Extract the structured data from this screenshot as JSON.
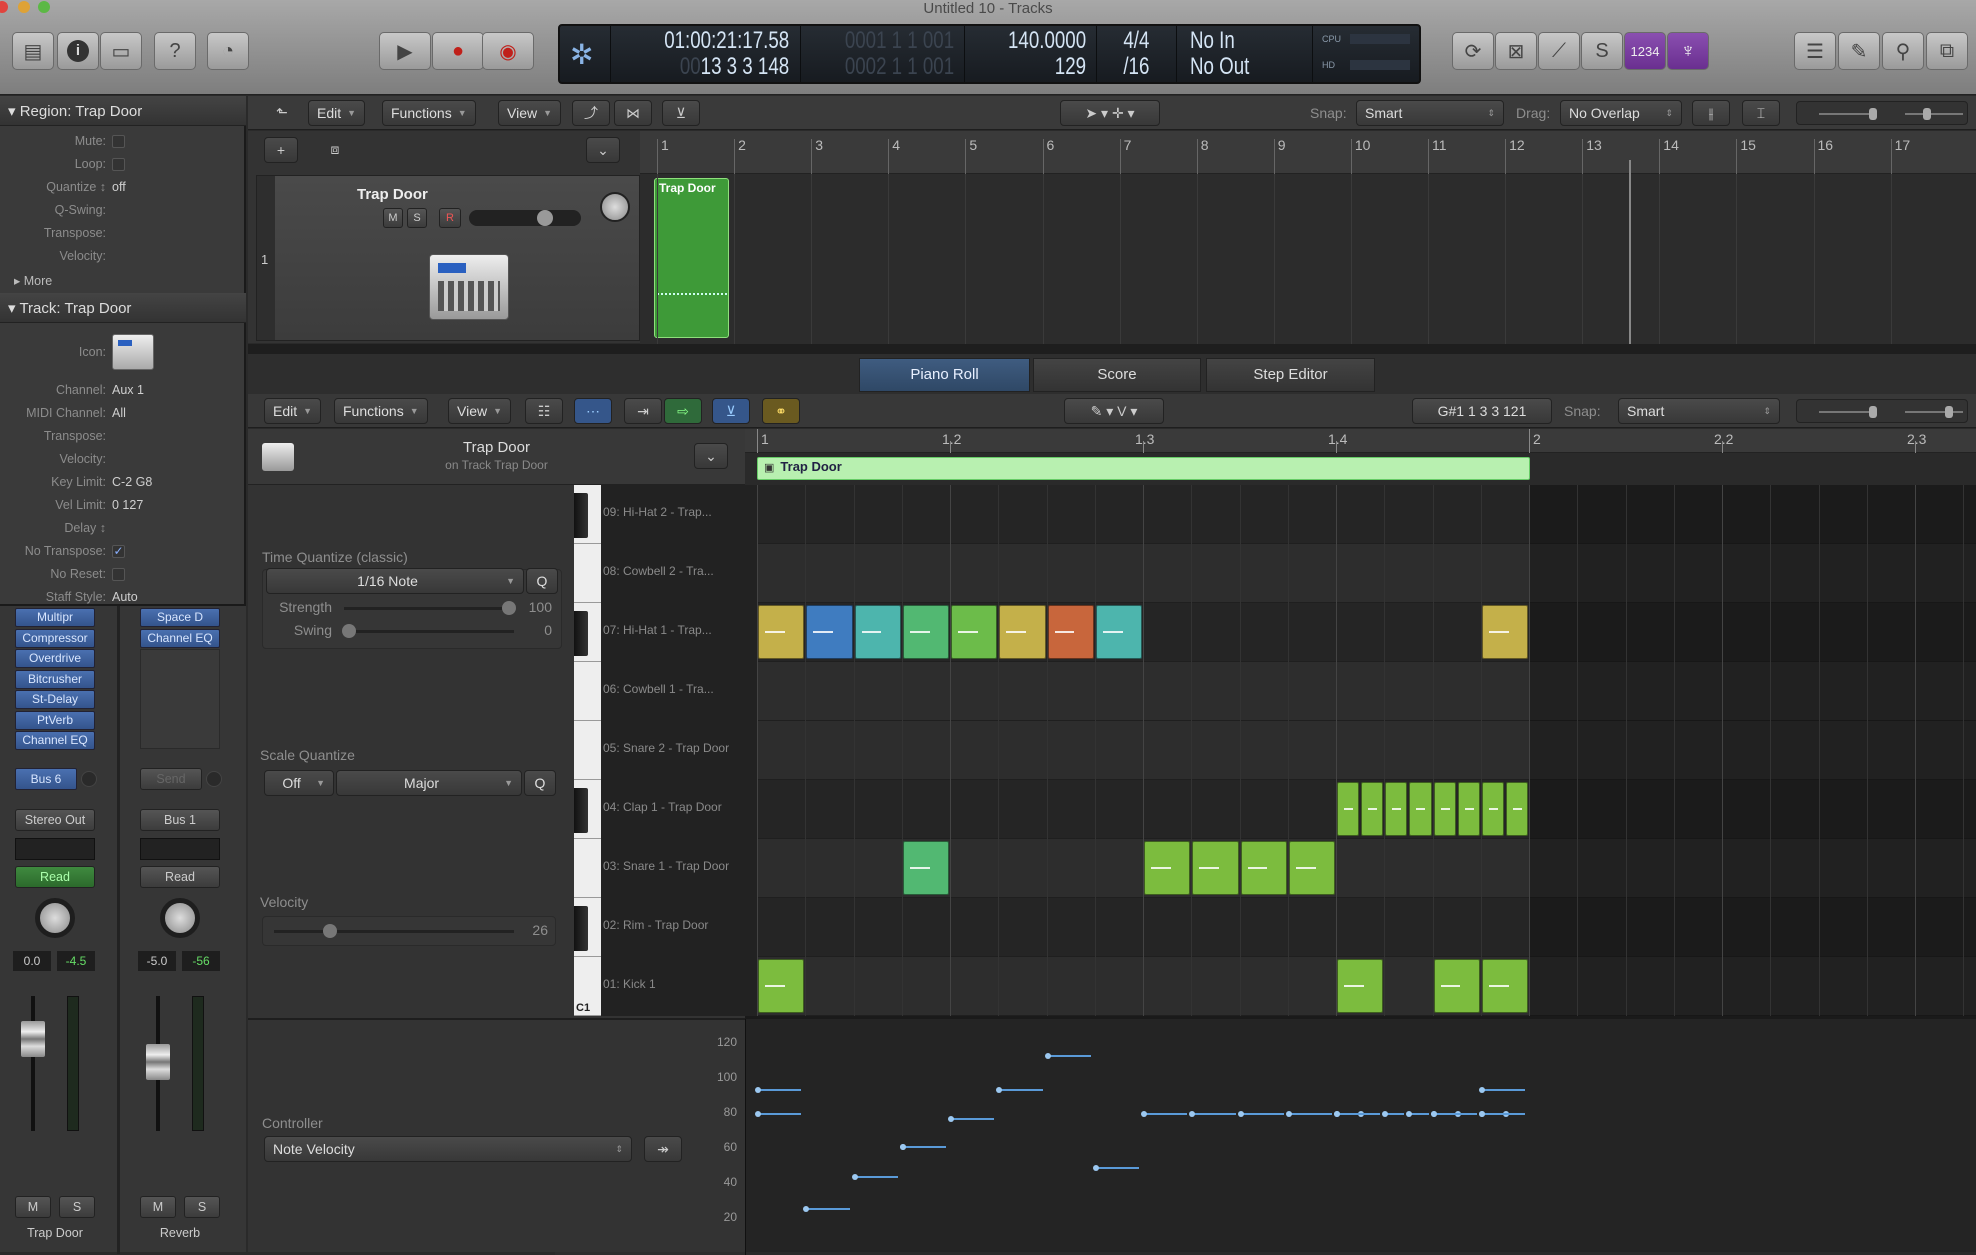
{
  "window": {
    "title": "Untitled 10 - Tracks"
  },
  "lcd": {
    "smpte": "01:00:21:17.58",
    "bars_dim": "00",
    "bars": "13 3 3 148",
    "locator_left": "0001 1 1 001",
    "locator_right": "0002 1 1 001",
    "tempo": "140.0000",
    "tempo_sub": "129",
    "signature": "4/4",
    "division": "/16",
    "midi_in": "No In",
    "midi_out": "No Out",
    "cpu_label": "CPU",
    "hd_label": "HD"
  },
  "control_bar": {
    "count_in_label": "1234"
  },
  "inspector": {
    "region_header": "Region: Trap Door",
    "region_rows": [
      {
        "label": "Mute:",
        "type": "check",
        "value": ""
      },
      {
        "label": "Loop:",
        "type": "check",
        "value": ""
      },
      {
        "label": "Quantize ↕",
        "type": "text",
        "value": "off"
      },
      {
        "label": "Q-Swing:",
        "type": "text",
        "value": ""
      },
      {
        "label": "Transpose:",
        "type": "text",
        "value": ""
      },
      {
        "label": "Velocity:",
        "type": "text",
        "value": ""
      }
    ],
    "more_label": "More",
    "track_header": "Track:  Trap Door",
    "icon_label": "Icon:",
    "track_rows": [
      {
        "label": "Channel:",
        "type": "text",
        "value": "Aux 1"
      },
      {
        "label": "MIDI Channel:",
        "type": "text",
        "value": "All"
      },
      {
        "label": "Transpose:",
        "type": "text",
        "value": ""
      },
      {
        "label": "Velocity:",
        "type": "text",
        "value": ""
      },
      {
        "label": "Key Limit:",
        "type": "text",
        "value": "C-2    G8"
      },
      {
        "label": "Vel Limit:",
        "type": "text",
        "value": "0    127"
      },
      {
        "label": "Delay ↕",
        "type": "text",
        "value": ""
      },
      {
        "label": "No Transpose:",
        "type": "checked",
        "value": "✓"
      },
      {
        "label": "No Reset:",
        "type": "check",
        "value": ""
      },
      {
        "label": "Staff Style:",
        "type": "text",
        "value": "Auto"
      }
    ]
  },
  "mixer": {
    "strips": [
      {
        "name": "Trap Door",
        "plugins": [
          "Multipr",
          "Compressor",
          "Overdrive",
          "Bitcrusher",
          "St-Delay",
          "PtVerb",
          "Channel EQ"
        ],
        "send": "Bus 6",
        "output": "Stereo Out",
        "automation": "Read",
        "automation_active": true,
        "volume": "0.0",
        "peak": "-4.5",
        "mute": "M",
        "solo": "S"
      },
      {
        "name": "Reverb",
        "plugins": [
          "Space D",
          "Channel EQ"
        ],
        "send": "Send",
        "output": "Bus 1",
        "automation": "Read",
        "automation_active": false,
        "volume": "-5.0",
        "peak": "-56",
        "mute": "M",
        "solo": "S"
      }
    ]
  },
  "tracks_area": {
    "menu": {
      "edit": "Edit",
      "functions": "Functions",
      "view": "View"
    },
    "snap_label": "Snap:",
    "snap_value": "Smart",
    "drag_label": "Drag:",
    "drag_value": "No Overlap",
    "ruler": [
      "1",
      "2",
      "3",
      "4",
      "5",
      "6",
      "7",
      "8",
      "9",
      "10",
      "11",
      "12",
      "13",
      "14",
      "15",
      "16",
      "17"
    ],
    "track": {
      "number": "1",
      "name": "Trap Door",
      "mute": "M",
      "solo": "S",
      "record": "R"
    },
    "region": {
      "name": "Trap Door"
    }
  },
  "editor": {
    "tabs": [
      {
        "label": "Piano Roll",
        "selected": true
      },
      {
        "label": "Score",
        "selected": false
      },
      {
        "label": "Step Editor",
        "selected": false
      }
    ],
    "menu": {
      "edit": "Edit",
      "functions": "Functions",
      "view": "View"
    },
    "tool_right": "V",
    "position_display": "G#1  1 3 3 121",
    "snap_label": "Snap:",
    "snap_value": "Smart",
    "region_title": "Trap Door",
    "region_subtitle": "on Track Trap Door",
    "time_quantize": {
      "label": "Time Quantize (classic)",
      "value": "1/16 Note",
      "q": "Q",
      "strength_label": "Strength",
      "strength": 100,
      "swing_label": "Swing",
      "swing": 0
    },
    "scale_quantize": {
      "label": "Scale Quantize",
      "mode": "Off",
      "scale": "Major",
      "q": "Q"
    },
    "velocity": {
      "label": "Velocity",
      "value": 26
    },
    "controller": {
      "label": "Controller",
      "value": "Note Velocity"
    },
    "ruler": [
      "1",
      "1.2",
      "1.3",
      "1.4",
      "2",
      "2.2",
      "2.3"
    ],
    "region_name": "Trap Door",
    "key_label": "C1",
    "lanes": [
      "09: Hi-Hat 2 - Trap...",
      "08: Cowbell 2 - Tra...",
      "07: Hi-Hat 1 - Trap...",
      "06: Cowbell 1 - Tra...",
      "05: Snare 2 - Trap Door",
      "04: Clap 1 - Trap Door",
      "03: Snare 1 - Trap Door",
      "02: Rim - Trap Door",
      "01: Kick 1"
    ],
    "velocity_axis": [
      "120",
      "100",
      "80",
      "60",
      "40",
      "20"
    ],
    "notes": [
      {
        "lane": 2,
        "pos16": 0,
        "len16": 1,
        "velocity": 94,
        "color": "#c4b04a"
      },
      {
        "lane": 2,
        "pos16": 1,
        "len16": 1,
        "velocity": 26,
        "color": "#3f7cc0"
      },
      {
        "lane": 2,
        "pos16": 2,
        "len16": 1,
        "velocity": 44,
        "color": "#4db5ad"
      },
      {
        "lane": 2,
        "pos16": 3,
        "len16": 1,
        "velocity": 61,
        "color": "#52b872"
      },
      {
        "lane": 2,
        "pos16": 4,
        "len16": 1,
        "velocity": 77,
        "color": "#6cbc4a"
      },
      {
        "lane": 2,
        "pos16": 5,
        "len16": 1,
        "velocity": 94,
        "color": "#c4b04a"
      },
      {
        "lane": 2,
        "pos16": 6,
        "len16": 1,
        "velocity": 113,
        "color": "#c8663c"
      },
      {
        "lane": 2,
        "pos16": 7,
        "len16": 1,
        "velocity": 49,
        "color": "#4db5ad"
      },
      {
        "lane": 2,
        "pos16": 15,
        "len16": 1,
        "velocity": 94,
        "color": "#c4b04a"
      },
      {
        "lane": 5,
        "pos16": 12,
        "len16": 0.5,
        "velocity": 80,
        "color": "#7cbc3e"
      },
      {
        "lane": 5,
        "pos16": 12.5,
        "len16": 0.5,
        "velocity": 80,
        "color": "#7cbc3e"
      },
      {
        "lane": 5,
        "pos16": 13,
        "len16": 0.5,
        "velocity": 80,
        "color": "#7cbc3e"
      },
      {
        "lane": 5,
        "pos16": 13.5,
        "len16": 0.5,
        "velocity": 80,
        "color": "#7cbc3e"
      },
      {
        "lane": 5,
        "pos16": 14,
        "len16": 0.5,
        "velocity": 80,
        "color": "#7cbc3e"
      },
      {
        "lane": 5,
        "pos16": 14.5,
        "len16": 0.5,
        "velocity": 80,
        "color": "#7cbc3e"
      },
      {
        "lane": 5,
        "pos16": 15,
        "len16": 0.5,
        "velocity": 80,
        "color": "#7cbc3e"
      },
      {
        "lane": 5,
        "pos16": 15.5,
        "len16": 0.5,
        "velocity": 80,
        "color": "#7cbc3e"
      },
      {
        "lane": 6,
        "pos16": 3,
        "len16": 1,
        "velocity": 61,
        "color": "#52b872"
      },
      {
        "lane": 6,
        "pos16": 8,
        "len16": 1,
        "velocity": 80,
        "color": "#7cbc3e"
      },
      {
        "lane": 6,
        "pos16": 9,
        "len16": 1,
        "velocity": 80,
        "color": "#7cbc3e"
      },
      {
        "lane": 6,
        "pos16": 10,
        "len16": 1,
        "velocity": 80,
        "color": "#7cbc3e"
      },
      {
        "lane": 6,
        "pos16": 11,
        "len16": 1,
        "velocity": 80,
        "color": "#7cbc3e"
      },
      {
        "lane": 8,
        "pos16": 0,
        "len16": 1,
        "velocity": 80,
        "color": "#7cbc3e"
      },
      {
        "lane": 8,
        "pos16": 12,
        "len16": 1,
        "velocity": 80,
        "color": "#7cbc3e"
      },
      {
        "lane": 8,
        "pos16": 14,
        "len16": 1,
        "velocity": 80,
        "color": "#7cbc3e"
      },
      {
        "lane": 8,
        "pos16": 15,
        "len16": 1,
        "velocity": 80,
        "color": "#7cbc3e"
      }
    ]
  }
}
